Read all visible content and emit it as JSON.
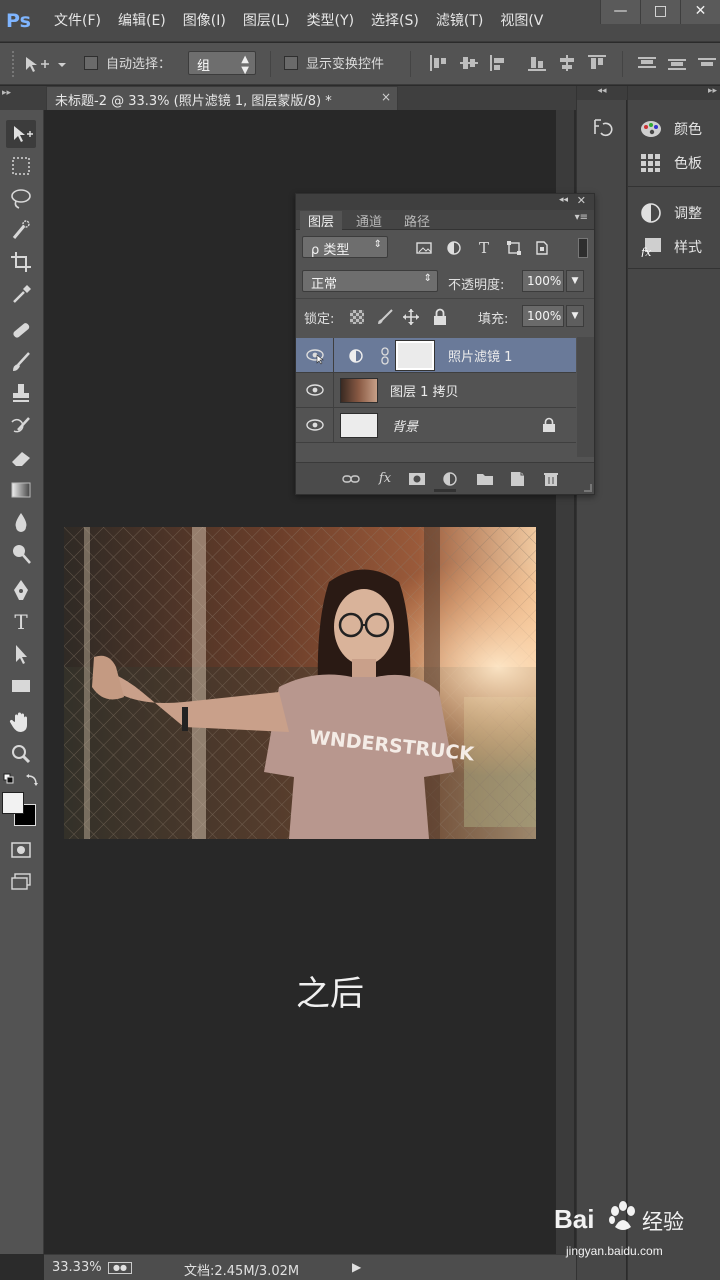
{
  "menubar": {
    "logo": "Ps",
    "menus": [
      "文件(F)",
      "编辑(E)",
      "图像(I)",
      "图层(L)",
      "类型(Y)",
      "选择(S)",
      "滤镜(T)",
      "视图(V"
    ],
    "window_controls": [
      "—",
      "□",
      "✕"
    ]
  },
  "options": {
    "auto_select_label": "自动选择：",
    "auto_select_value": "组",
    "show_transform_label": "显示变换控件"
  },
  "document": {
    "tab_title": "未标题-2 @ 33.3% (照片滤镜 1, 图层蒙版/8) *",
    "close": "×",
    "caption": "之后"
  },
  "status": {
    "zoom": "33.33%",
    "doc_size": "文档:2.45M/3.02M"
  },
  "right_panels": {
    "color": "颜色",
    "swatches": "色板",
    "adjustments": "调整",
    "styles": "样式"
  },
  "layers_panel": {
    "tabs": [
      "图层",
      "通道",
      "路径"
    ],
    "filter_kind": "ρ 类型",
    "blend_mode": "正常",
    "opacity_label": "不透明度:",
    "opacity_value": "100%",
    "lock_label": "锁定:",
    "fill_label": "填充:",
    "fill_value": "100%",
    "layers": [
      {
        "name": "照片滤镜 1",
        "selected": true
      },
      {
        "name": "图层 1 拷贝",
        "selected": false
      },
      {
        "name": "背景",
        "selected": false
      }
    ]
  },
  "watermark": {
    "brand": "Bai",
    "brand_cn": "经验",
    "url": "jingyan.baidu.com"
  }
}
